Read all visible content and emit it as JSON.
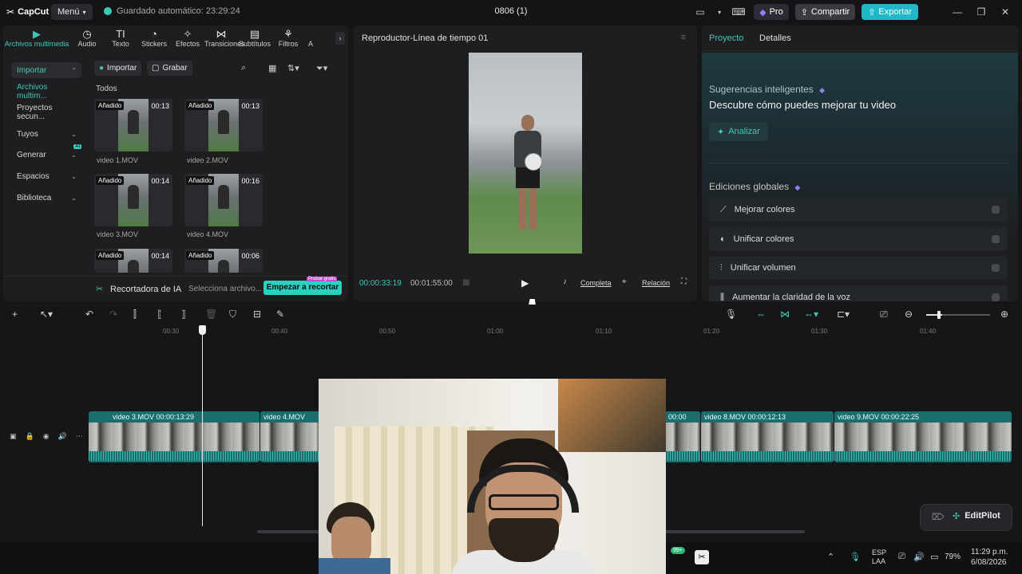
{
  "titlebar": {
    "app_name": "CapCut",
    "menu_label": "Menú",
    "autosave_text": "Guardado automático: 23:29:24",
    "doc_title": "0806 (1)",
    "pro_label": "Pro",
    "share_label": "Compartir",
    "export_label": "Exportar"
  },
  "left_tabs": [
    {
      "label": "Archivos multimedia",
      "icon": "▶"
    },
    {
      "label": "Audio",
      "icon": "◷"
    },
    {
      "label": "Texto",
      "icon": "TI"
    },
    {
      "label": "Stickers",
      "icon": "◔"
    },
    {
      "label": "Efectos",
      "icon": "✧"
    },
    {
      "label": "Transiciones",
      "icon": "⋈"
    },
    {
      "label": "Subtítulos",
      "icon": "▤"
    },
    {
      "label": "Filtros",
      "icon": "⚘"
    },
    {
      "label": "A",
      "icon": ""
    }
  ],
  "sidenav": {
    "importar": "Importar",
    "archivos": "Archivos multim...",
    "proyectos": "Proyectos secun...",
    "tuyos": "Tuyos",
    "generar": "Generar",
    "espacios": "Espacios",
    "biblioteca": "Biblioteca",
    "ai_badge": "AI"
  },
  "media_toolbar": {
    "import_label": "Importar",
    "record_label": "Grabar",
    "filter_all": "Todos"
  },
  "media_items": [
    {
      "badge": "Añadido",
      "duration": "00:13",
      "name": "video 1.MOV"
    },
    {
      "badge": "Añadido",
      "duration": "00:13",
      "name": "video 2.MOV"
    },
    {
      "badge": "Añadido",
      "duration": "00:14",
      "name": "video 3.MOV"
    },
    {
      "badge": "Añadido",
      "duration": "00:16",
      "name": "video 4.MOV"
    },
    {
      "badge": "Añadido",
      "duration": "00:14",
      "name": ""
    },
    {
      "badge": "Añadido",
      "duration": "00:06",
      "name": ""
    }
  ],
  "left_footer": {
    "ai_cutter": "Recortadora de IA",
    "select_hint": "Selecciona archivo...",
    "start_cut": "Empezar a recortar",
    "try_free": "Probar gratis"
  },
  "player": {
    "title": "Reproductor-Línea de tiempo 01",
    "current_time": "00:00:33:19",
    "total_time": "00:01:55:00",
    "full_label": "Completa",
    "ratio_label": "Relación"
  },
  "right_panel": {
    "tab_project": "Proyecto",
    "tab_details": "Detalles",
    "smart_title": "Sugerencias inteligentes",
    "smart_main": "Descubre cómo puedes mejorar tu video",
    "analyze": "Analizar",
    "global_title": "Ediciones globales",
    "options": [
      "Mejorar colores",
      "Unificar colores",
      "Unificar volumen",
      "Aumentar la claridad de la voz"
    ]
  },
  "ruler_ticks": [
    "00:30",
    "00:40",
    "00:50",
    "01:00",
    "01:10",
    "01:20",
    "01:30",
    "01:40"
  ],
  "clips": [
    {
      "label": "video 3.MOV   00:00:13:29"
    },
    {
      "label": "video 4.MOV"
    },
    {
      "label": "00:00"
    },
    {
      "label": "video 8.MOV   00:00:12:13"
    },
    {
      "label": "video 9.MOV   00:00:22:25"
    }
  ],
  "editpilot_label": "EditPilot",
  "taskbar": {
    "lang": "ESP\nLAA",
    "battery": "79%",
    "time": "11:29 p.m.",
    "date": "6/08/2026",
    "notif_count": "99+"
  },
  "colors": {
    "accent": "#3fc8b5",
    "export": "#1fb8c9",
    "clip": "#1a6f6e"
  }
}
